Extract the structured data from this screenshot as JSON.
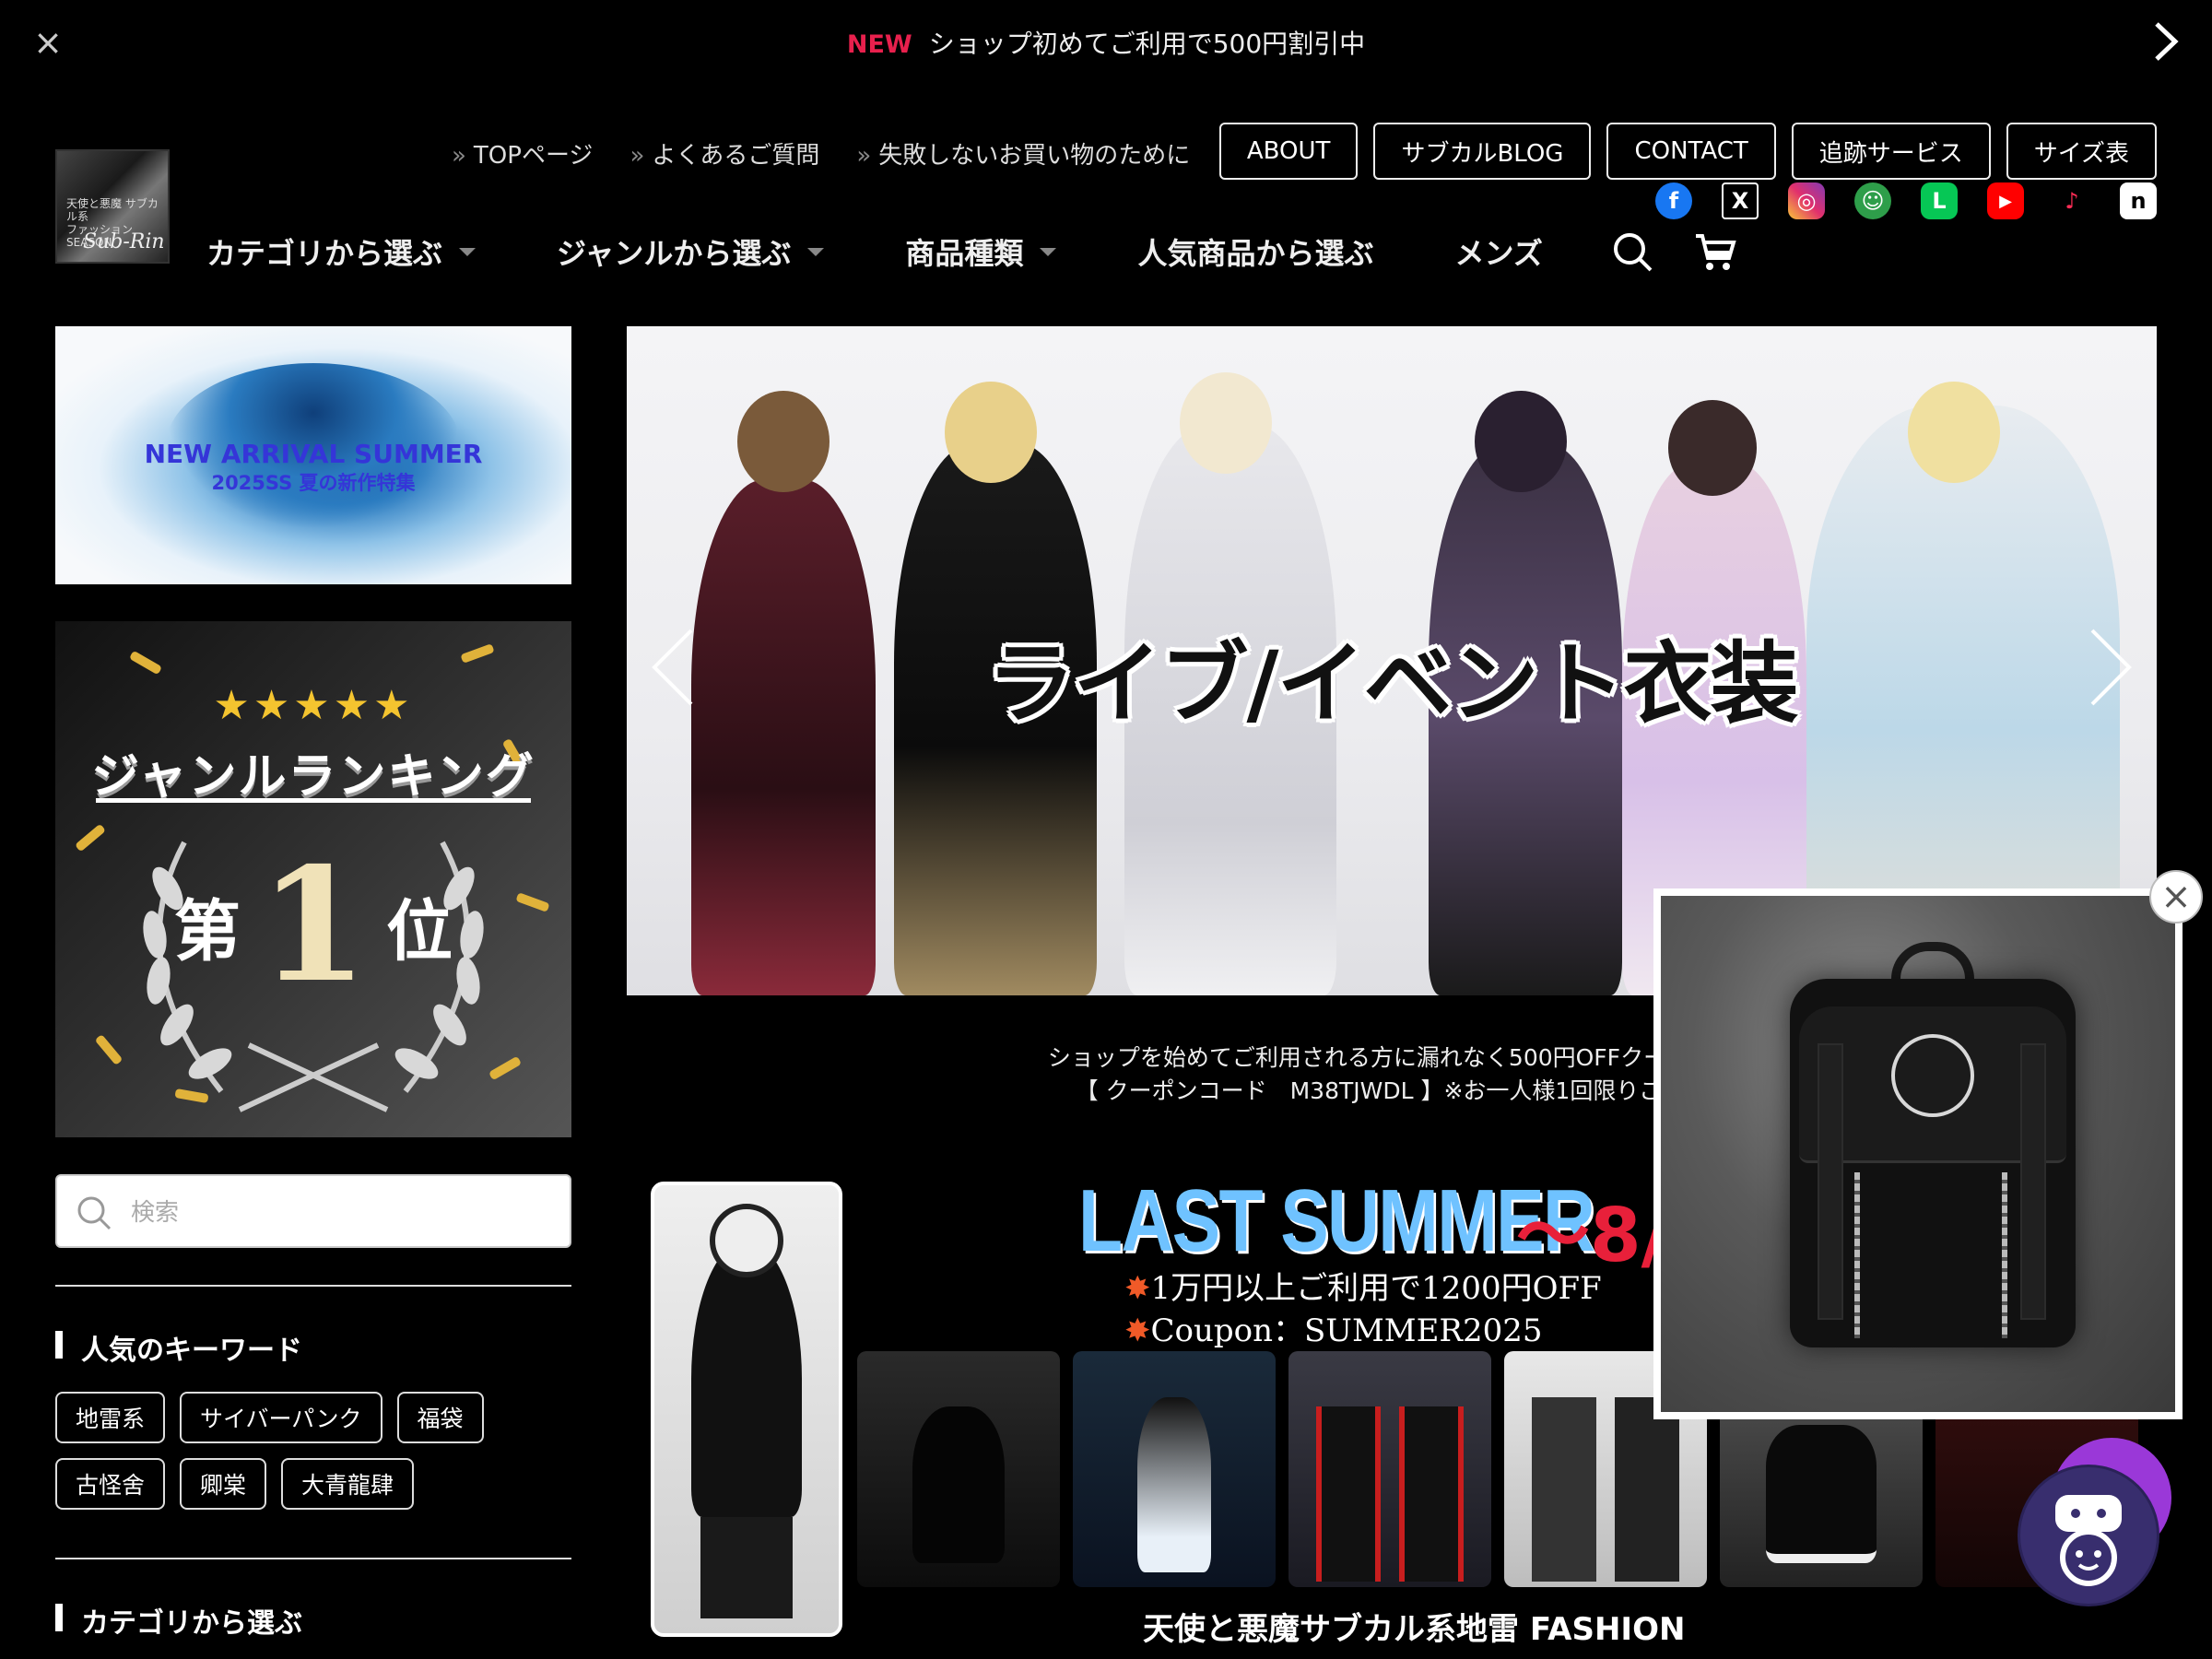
{
  "announcement": {
    "badge": "NEW",
    "text": "ショップ初めてご利用で500円割引中"
  },
  "logo": {
    "line1": "天使と悪魔 サブカル系",
    "line2": "ファッション SEASON",
    "script": "Sub-Rin"
  },
  "header": {
    "top_links": [
      "TOPページ",
      "よくあるご質問",
      "失敗しないお買い物のために"
    ],
    "buttons": [
      "ABOUT",
      "サブカルBLOG",
      "CONTACT",
      "追跡サービス",
      "サイズ表"
    ],
    "social": [
      {
        "name": "facebook-icon",
        "glyph": "f",
        "color": "#1877f2"
      },
      {
        "name": "x-twitter-icon",
        "glyph": "X",
        "color": "#000000"
      },
      {
        "name": "instagram-icon",
        "glyph": "◎",
        "color": "#d6249f"
      },
      {
        "name": "frog-icon",
        "glyph": "☺",
        "color": "#2e9e4a"
      },
      {
        "name": "line-icon",
        "glyph": "L",
        "color": "#06c755"
      },
      {
        "name": "youtube-icon",
        "glyph": "▶",
        "color": "#ff0000"
      },
      {
        "name": "tiktok-icon",
        "glyph": "♪",
        "color": "#111111"
      },
      {
        "name": "note-icon",
        "glyph": "n",
        "color": "#ffffff"
      }
    ],
    "nav": [
      {
        "label": "カテゴリから選ぶ",
        "dropdown": true
      },
      {
        "label": "ジャンルから選ぶ",
        "dropdown": true
      },
      {
        "label": "商品種類",
        "dropdown": true
      },
      {
        "label": "人気商品から選ぶ",
        "dropdown": false
      },
      {
        "label": "メンズ",
        "dropdown": false
      }
    ]
  },
  "sidebar": {
    "new_arrival": {
      "title": "NEW ARRIVAL SUMMER",
      "subtitle": "2025SS 夏の新作特集"
    },
    "ranking": {
      "stars": "★★★★★",
      "title": "ジャンルランキング",
      "rank_prefix": "第",
      "rank_number": "1",
      "rank_suffix": "位"
    },
    "search_placeholder": "検索",
    "keywords_heading": "人気のキーワード",
    "keywords": [
      "地雷系",
      "サイバーパンク",
      "福袋",
      "古怪舍",
      "卿棠",
      "大青龍肆"
    ],
    "category_heading": "カテゴリから選ぶ"
  },
  "hero": {
    "caption": "ライブ/イベント衣装"
  },
  "coupon": {
    "line1": "ショップを始めてご利用される方に漏れなく500円OFFクーポンを",
    "line2": "【 クーポンコード　M38TJWDL 】※お一人様1回限りご利用"
  },
  "summer_banner": {
    "title": "LAST SUMMER",
    "date": "〜8/",
    "offer": "1万円以上ご利用で1200円OFF",
    "coupon": "Coupon：SUMMER2025",
    "footer": "天使と悪魔サブカル系地雷 FASHION"
  },
  "colors": {
    "accent_new": "#e8204d",
    "summer_title": "#6fc2ff",
    "summer_date": "#e8203a",
    "chat_purple": "#9a38d8"
  }
}
